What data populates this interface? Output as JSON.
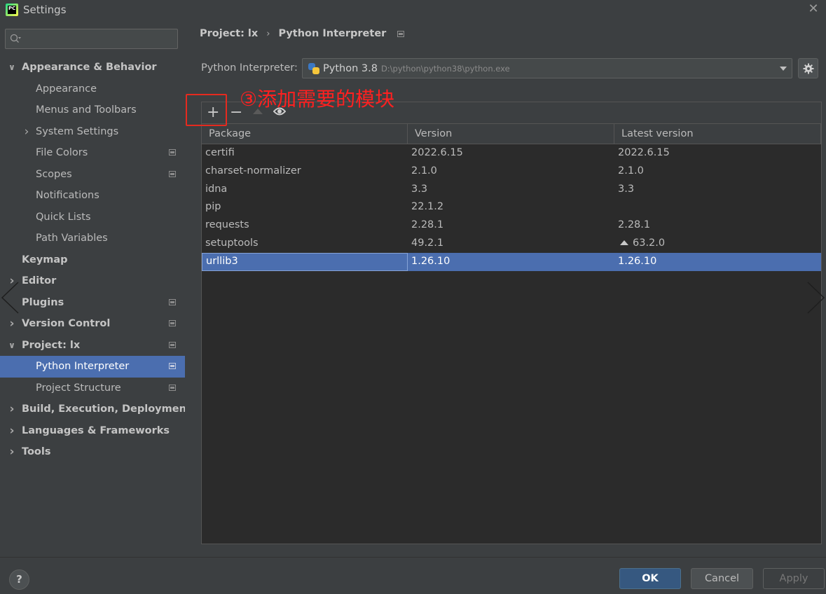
{
  "window": {
    "title": "Settings",
    "logo_text": "PC"
  },
  "sidebar": {
    "search_placeholder": "",
    "items": [
      {
        "label": "Appearance & Behavior",
        "level": 0,
        "bold": true,
        "chevron": "down"
      },
      {
        "label": "Appearance",
        "level": 1
      },
      {
        "label": "Menus and Toolbars",
        "level": 1
      },
      {
        "label": "System Settings",
        "level": 1,
        "chevron": "right"
      },
      {
        "label": "File Colors",
        "level": 1,
        "project_icon": true
      },
      {
        "label": "Scopes",
        "level": 1,
        "project_icon": true
      },
      {
        "label": "Notifications",
        "level": 1
      },
      {
        "label": "Quick Lists",
        "level": 1
      },
      {
        "label": "Path Variables",
        "level": 1
      },
      {
        "label": "Keymap",
        "level": 0,
        "bold": true
      },
      {
        "label": "Editor",
        "level": 0,
        "bold": true,
        "chevron": "right"
      },
      {
        "label": "Plugins",
        "level": 0,
        "bold": true,
        "project_icon": true
      },
      {
        "label": "Version Control",
        "level": 0,
        "bold": true,
        "chevron": "right",
        "project_icon": true
      },
      {
        "label": "Project: lx",
        "level": 0,
        "bold": true,
        "chevron": "down",
        "project_icon": true
      },
      {
        "label": "Python Interpreter",
        "level": 1,
        "selected": true,
        "project_icon": true
      },
      {
        "label": "Project Structure",
        "level": 1,
        "project_icon": true
      },
      {
        "label": "Build, Execution, Deployment",
        "level": 0,
        "bold": true,
        "chevron": "right"
      },
      {
        "label": "Languages & Frameworks",
        "level": 0,
        "bold": true,
        "chevron": "right"
      },
      {
        "label": "Tools",
        "level": 0,
        "bold": true,
        "chevron": "right"
      }
    ]
  },
  "breadcrumb": {
    "project": "Project: lx",
    "separator": "›",
    "page": "Python Interpreter"
  },
  "interpreter": {
    "label": "Python Interpreter:",
    "name": "Python 3.8",
    "path": "D:\\python\\python38\\python.exe"
  },
  "annotation": {
    "text": "③添加需要的模块",
    "color": "#ff2020"
  },
  "toolbar": {
    "add": "+",
    "remove": "−"
  },
  "packages": {
    "columns": [
      "Package",
      "Version",
      "Latest version"
    ],
    "rows": [
      {
        "package": "certifi",
        "version": "2022.6.15",
        "latest": "2022.6.15",
        "upgrade": false
      },
      {
        "package": "charset-normalizer",
        "version": "2.1.0",
        "latest": "2.1.0",
        "upgrade": false
      },
      {
        "package": "idna",
        "version": "3.3",
        "latest": "3.3",
        "upgrade": false
      },
      {
        "package": "pip",
        "version": "22.1.2",
        "latest": "",
        "upgrade": false
      },
      {
        "package": "requests",
        "version": "2.28.1",
        "latest": "2.28.1",
        "upgrade": false
      },
      {
        "package": "setuptools",
        "version": "49.2.1",
        "latest": "63.2.0",
        "upgrade": true
      },
      {
        "package": "urllib3",
        "version": "1.26.10",
        "latest": "1.26.10",
        "upgrade": false,
        "selected": true
      }
    ]
  },
  "footer": {
    "help": "?",
    "ok": "OK",
    "cancel": "Cancel",
    "apply": "Apply"
  },
  "colors": {
    "accent": "#4b6eaf",
    "background": "#3c3f41",
    "table_bg": "#2b2b2b",
    "ok_button": "#365880"
  }
}
